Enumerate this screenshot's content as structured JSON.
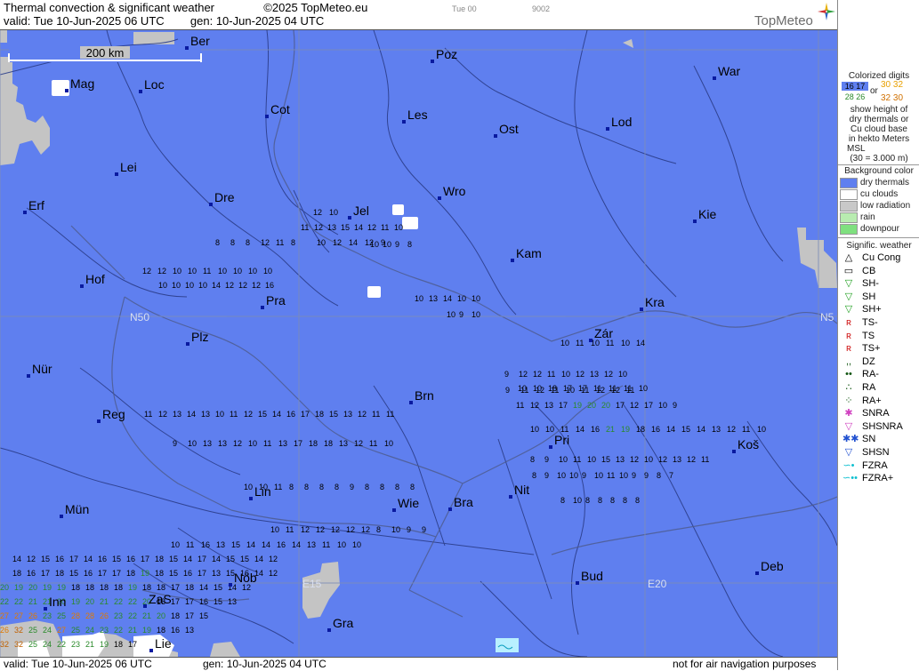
{
  "header": {
    "title": "Thermal convection & significant weather",
    "copyright": "©2025 TopMeteo.eu",
    "small_time": "Tue 00",
    "small_code": "9002",
    "valid": "valid:  Tue  10-Jun-2025  06 UTC",
    "gen": "gen: 10-Jun-2025 04 UTC",
    "brand": "TopMeteo"
  },
  "footer": {
    "valid": "valid:  Tue  10-Jun-2025  06 UTC",
    "gen": "gen: 10-Jun-2025 04 UTC",
    "disclaimer": "not for air navigation purposes"
  },
  "map": {
    "scale_label": "200 km",
    "colors": {
      "dry": "#5f7fef",
      "cu": "#ffffff",
      "low": "#c4c4c4",
      "water": "#2b3d8a",
      "grid": "#7c8db6"
    },
    "grid_labels": [
      {
        "text": "N50"
      },
      {
        "text": "N5"
      },
      {
        "text": "E15"
      },
      {
        "text": "E20"
      }
    ],
    "cities": [
      {
        "name": "Ber"
      },
      {
        "name": "Poz"
      },
      {
        "name": "War"
      },
      {
        "name": "Mag"
      },
      {
        "name": "Loc"
      },
      {
        "name": "Cot"
      },
      {
        "name": "Les"
      },
      {
        "name": "Ost"
      },
      {
        "name": "Lod"
      },
      {
        "name": "Lei"
      },
      {
        "name": "Erf"
      },
      {
        "name": "Dre"
      },
      {
        "name": "Jel"
      },
      {
        "name": "Wro"
      },
      {
        "name": "Kie"
      },
      {
        "name": "Kam"
      },
      {
        "name": "Hof"
      },
      {
        "name": "Pra"
      },
      {
        "name": "Kra"
      },
      {
        "name": "Zár"
      },
      {
        "name": "Plz"
      },
      {
        "name": "Nür"
      },
      {
        "name": "Brn"
      },
      {
        "name": "Reg"
      },
      {
        "name": "Pri"
      },
      {
        "name": "Koš"
      },
      {
        "name": "Lin"
      },
      {
        "name": "Nit"
      },
      {
        "name": "Mün"
      },
      {
        "name": "Wie"
      },
      {
        "name": "Bra"
      },
      {
        "name": "Deb"
      },
      {
        "name": "Nöb"
      },
      {
        "name": "Bud"
      },
      {
        "name": "Inn"
      },
      {
        "name": "ZaS"
      },
      {
        "name": "Gra"
      },
      {
        "name": "Lie"
      }
    ],
    "digit_rows": [
      {
        "vals": "12 10"
      },
      {
        "vals": "11 12 13 15 14 12 11 10"
      },
      {
        "vals": "10 12 14 12 9"
      },
      {
        "vals": "8 8 8 12 11 8"
      },
      {
        "vals": "10 10 9 8"
      },
      {
        "vals": "12 12 10 10 11 10 10 10 10"
      },
      {
        "vals": "10 10 10 10 14 12 12 12 16"
      },
      {
        "vals": "10 13 14 10 10"
      },
      {
        "vals": "10 9 10"
      },
      {
        "vals": "10 11 10 11 10 14"
      },
      {
        "vals": "9 12 12 11 10 12 13 12 10"
      },
      {
        "vals": "9 11 12 11 10 11 12 12 11"
      },
      {
        "vals": "10 10 18 17 17 11 11 11 10"
      },
      {
        "vals": "11 12 13 17 19 20 20 17 12 17 10 9"
      },
      {
        "vals": "11 12 13 14 13 10 11 12 15 14 16 17 18 15 13 12 11 11"
      },
      {
        "vals": "10 10 11 14 16 21 19 18 16 14 15 14 13 12 11 10"
      },
      {
        "vals": "9 10 13 13 12 10 11 13 17 18 18 13 12 11 10"
      },
      {
        "vals": "8 9 10 11 10 15 13 12 10 12 13 12 11"
      },
      {
        "vals": "8 9 10 10 9 10 11 10 9 9 8 7"
      },
      {
        "vals": "10 10 11 8 8 8 8 9 8 8 8 8"
      },
      {
        "vals": "8 10 8 8 8 8 8"
      },
      {
        "vals": "10 11 12 12 12 12 12 8 10 9 9"
      },
      {
        "vals": "10 11 16 13 15 14 14 16 14 13 11 10 10"
      },
      {
        "vals": "14 12 15 16 17 14 16 15 16 17 18 15 14 17 14 15 15 14 12"
      },
      {
        "vals": "18 16 17 18 15 16 17 17 18 19 18 15 16 17 13 15 16 14 12"
      },
      {
        "vals": "20 19 20 19 19 18 18 18 18 19 18 18 17 18 14 15 14 12"
      },
      {
        "vals": "22 22 21 21 20 19 20 21 22 22 20 18 17 17 16 15 13"
      },
      {
        "vals": "27 27 26 23 25 28 28 26 23 22 21 20 18 17 15"
      },
      {
        "vals": "26 32 25 24 27 25 24 23 22 21 19 18 16 13"
      },
      {
        "vals": "32 32 25 24 22 23 21 19 18 17"
      }
    ]
  },
  "legend": {
    "colorized_title": "Colorized digits",
    "sample_a": "16 17",
    "sample_b": "28 26",
    "or": "or",
    "sample_c": "30 32",
    "sample_d": "32 30",
    "desc1": "show height of",
    "desc2": "dry thermals or",
    "desc3": "Cu cloud base",
    "desc4": "in hekto Meters",
    "desc5": "MSL",
    "desc6": "(30 = 3.000 m)",
    "bg_title": "Background color",
    "bg_items": [
      {
        "label": "dry thermals",
        "color": "#5f7fef"
      },
      {
        "label": "cu clouds",
        "color": "#ffffff"
      },
      {
        "label": "low radiation",
        "color": "#c8c8c8"
      },
      {
        "label": "rain",
        "color": "#b8ecb0"
      },
      {
        "label": "downpour",
        "color": "#7fe07f"
      }
    ],
    "wx_title": "Signific. weather",
    "wx_items": [
      {
        "label": "Cu Cong",
        "sym": "△",
        "color": "#000000"
      },
      {
        "label": "CB",
        "sym": "▭",
        "color": "#000000"
      },
      {
        "label": "SH-",
        "sym": "▽",
        "color": "#22a022"
      },
      {
        "label": "SH",
        "sym": "▽",
        "color": "#22a022"
      },
      {
        "label": "SH+",
        "sym": "▽",
        "color": "#22a022"
      },
      {
        "label": "TS-",
        "sym": "ʀ",
        "color": "#d01818"
      },
      {
        "label": "TS",
        "sym": "ʀ",
        "color": "#d01818"
      },
      {
        "label": "TS+",
        "sym": "ʀ",
        "color": "#d01818"
      },
      {
        "label": "DZ",
        "sym": ",,",
        "color": "#115511"
      },
      {
        "label": "RA-",
        "sym": "••",
        "color": "#115511"
      },
      {
        "label": "RA",
        "sym": "∴",
        "color": "#115511"
      },
      {
        "label": "RA+",
        "sym": "⁘",
        "color": "#115511"
      },
      {
        "label": "SNRA",
        "sym": "✱",
        "color": "#d040c0"
      },
      {
        "label": "SHSNRA",
        "sym": "▽",
        "color": "#d040c0"
      },
      {
        "label": "SN",
        "sym": "✱✱",
        "color": "#2050d0"
      },
      {
        "label": "SHSN",
        "sym": "▽",
        "color": "#2050d0"
      },
      {
        "label": "FZRA",
        "sym": "∽•",
        "color": "#10c0d0"
      },
      {
        "label": "FZRA+",
        "sym": "∽••",
        "color": "#10c0d0"
      }
    ]
  }
}
